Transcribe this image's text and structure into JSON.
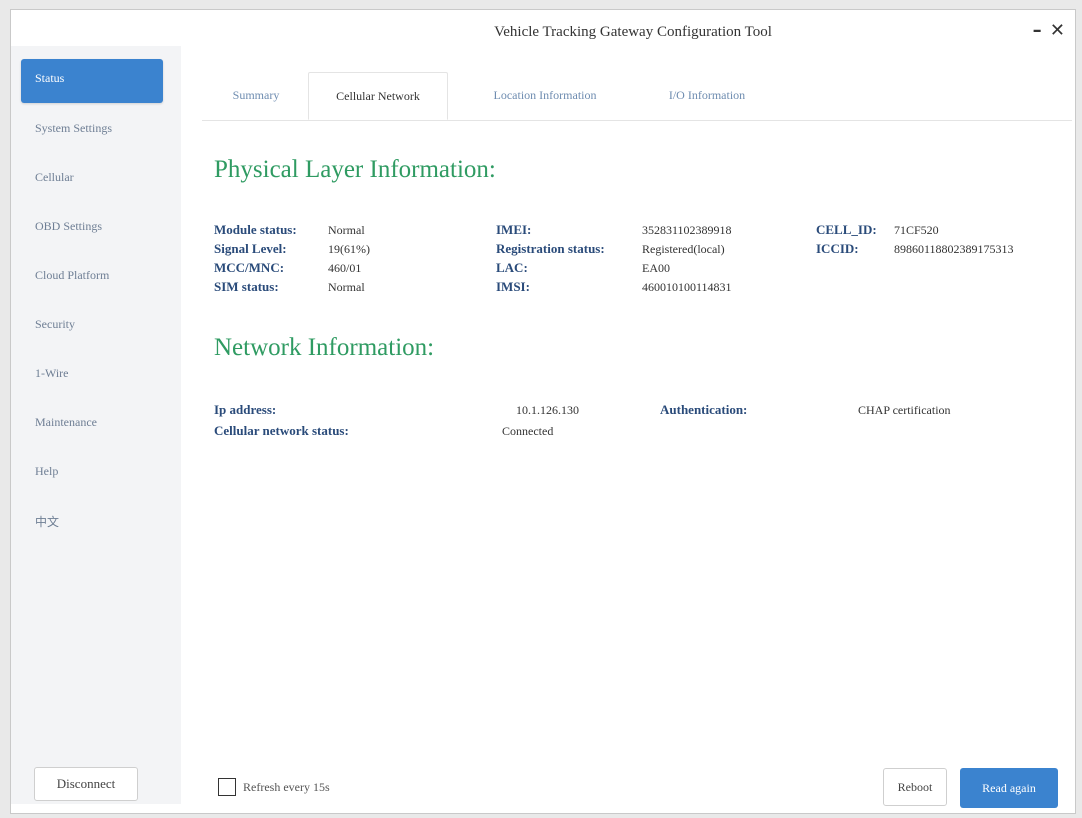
{
  "window": {
    "title": "Vehicle Tracking Gateway Configuration Tool",
    "minimize_label": "–",
    "close_label": "✕"
  },
  "sidebar": {
    "items": [
      {
        "label": "Status",
        "active": true
      },
      {
        "label": "System Settings"
      },
      {
        "label": "Cellular"
      },
      {
        "label": "OBD Settings"
      },
      {
        "label": "Cloud Platform"
      },
      {
        "label": "Security"
      },
      {
        "label": "1-Wire"
      },
      {
        "label": "Maintenance"
      },
      {
        "label": "Help"
      },
      {
        "label": "中文"
      }
    ],
    "disconnect_label": "Disconnect"
  },
  "tabs": [
    {
      "label": "Summary"
    },
    {
      "label": "Cellular Network",
      "active": true
    },
    {
      "label": "Location Information"
    },
    {
      "label": "I/O Information"
    }
  ],
  "physical": {
    "title": "Physical Layer Information:",
    "fields": {
      "module_status": {
        "label": "Module status:",
        "value": "Normal"
      },
      "signal_level": {
        "label": "Signal Level:",
        "value": "19(61%)"
      },
      "mcc_mnc": {
        "label": "MCC/MNC:",
        "value": "460/01"
      },
      "sim_status": {
        "label": "SIM status:",
        "value": "Normal"
      },
      "imei": {
        "label": "IMEI:",
        "value": "352831102389918"
      },
      "registration": {
        "label": "Registration status:",
        "value": "Registered(local)"
      },
      "lac": {
        "label": "LAC:",
        "value": "EA00"
      },
      "imsi": {
        "label": "IMSI:",
        "value": "460010100114831"
      },
      "cell_id": {
        "label": "CELL_ID:",
        "value": "71CF520"
      },
      "iccid": {
        "label": "ICCID:",
        "value": "89860118802389175313"
      }
    }
  },
  "network": {
    "title": "Network Information:",
    "fields": {
      "ip": {
        "label": "Ip address:",
        "value": "10.1.126.130"
      },
      "cell_status": {
        "label": "Cellular network status:",
        "value": "Connected"
      },
      "auth": {
        "label": "Authentication:",
        "value": "CHAP certification"
      }
    }
  },
  "footer": {
    "refresh_label": "Refresh every 15s",
    "reboot_label": "Reboot",
    "read_again_label": "Read again"
  },
  "colors": {
    "accent": "#3b83cf",
    "section_title": "#2f9b62",
    "label": "#2a4b7a"
  }
}
